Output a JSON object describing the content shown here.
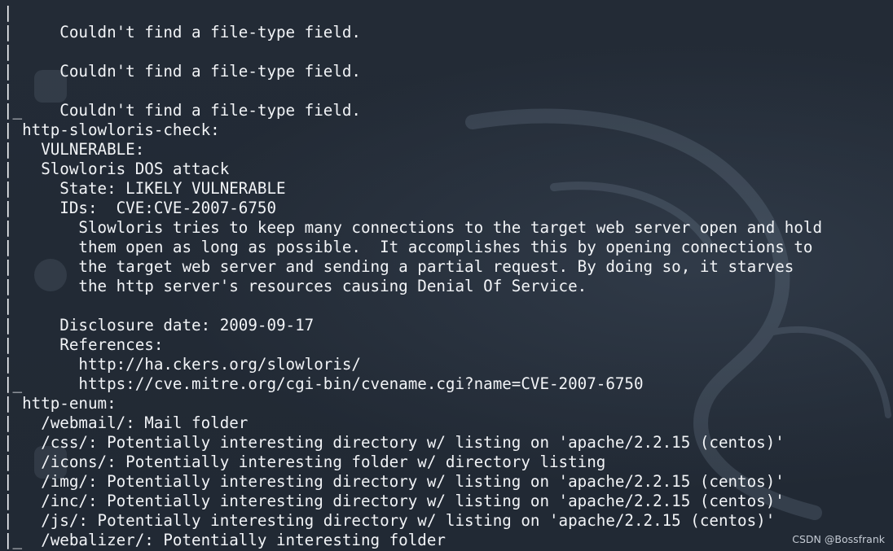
{
  "terminal": {
    "lines": [
      "|",
      "|     Couldn't find a file-type field.",
      "|",
      "|     Couldn't find a file-type field.",
      "|",
      "|_    Couldn't find a file-type field.",
      "| http-slowloris-check:",
      "|   VULNERABLE:",
      "|   Slowloris DOS attack",
      "|     State: LIKELY VULNERABLE",
      "|     IDs:  CVE:CVE-2007-6750",
      "|       Slowloris tries to keep many connections to the target web server open and hold",
      "|       them open as long as possible.  It accomplishes this by opening connections to",
      "|       the target web server and sending a partial request. By doing so, it starves",
      "|       the http server's resources causing Denial Of Service.",
      "|",
      "|     Disclosure date: 2009-09-17",
      "|     References:",
      "|       http://ha.ckers.org/slowloris/",
      "|_      https://cve.mitre.org/cgi-bin/cvename.cgi?name=CVE-2007-6750",
      "| http-enum:",
      "|   /webmail/: Mail folder",
      "|   /css/: Potentially interesting directory w/ listing on 'apache/2.2.15 (centos)'",
      "|   /icons/: Potentially interesting folder w/ directory listing",
      "|   /img/: Potentially interesting directory w/ listing on 'apache/2.2.15 (centos)'",
      "|   /inc/: Potentially interesting directory w/ listing on 'apache/2.2.15 (centos)'",
      "|   /js/: Potentially interesting directory w/ listing on 'apache/2.2.15 (centos)'",
      "|_  /webalizer/: Potentially interesting folder"
    ]
  },
  "watermark": "CSDN @Bossfrank",
  "colors": {
    "background": "#222a35",
    "text": "#f2f4f7"
  }
}
